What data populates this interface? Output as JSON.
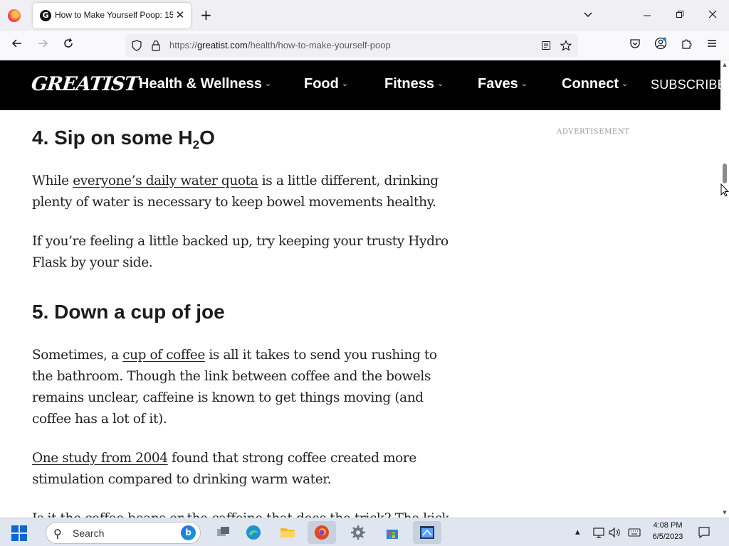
{
  "browser": {
    "tab_title": "How to Make Yourself Poop: 15",
    "tab_favicon_glyph": "G",
    "url_scheme": "https://",
    "url_domain": "greatist.com",
    "url_path": "/health/how-to-make-yourself-poop",
    "new_tab_glyph": "+",
    "close_glyph": "✕"
  },
  "site": {
    "logo": "GREATIST",
    "menu": [
      {
        "label": "Health & Wellness"
      },
      {
        "label": "Food"
      },
      {
        "label": "Fitness"
      },
      {
        "label": "Faves"
      },
      {
        "label": "Connect"
      }
    ],
    "subscribe": "SUBSCRIBE",
    "chevron": "⌄"
  },
  "article": {
    "section4": {
      "heading_prefix": "4. Sip on some H",
      "heading_sub": "2",
      "heading_suffix": "O",
      "p1_before": "While ",
      "p1_link": "everyone’s daily water quota",
      "p1_after": " is a little different, drinking plenty of water is necessary to keep bowel movements healthy.",
      "p2": "If you’re feeling a little backed up, try keeping your trusty Hydro Flask by your side."
    },
    "section5": {
      "heading": "5. Down a cup of joe",
      "p1_before": "Sometimes, a ",
      "p1_link": "cup of coffee",
      "p1_after": " is all it takes to send you rushing to the bathroom. Though the link between coffee and the bowels remains unclear, caffeine is known to get things moving (and coffee has a lot of it).",
      "p2_link": "One study from 2004",
      "p2_after": " found that strong coffee created more stimulation compared to drinking warm water.",
      "p3_partial": "Is it the coffee beans or the caffeine that does the trick? The kick-start"
    }
  },
  "sidebar": {
    "ad_label": "ADVERTISEMENT"
  },
  "taskbar": {
    "search_placeholder": "Search",
    "time": "4:08 PM",
    "date": "6/5/2023",
    "colors": {
      "brand_black": "#000000",
      "windows_blue": "#0a68d0",
      "taskbar_bg": "#dfe6f0"
    }
  }
}
